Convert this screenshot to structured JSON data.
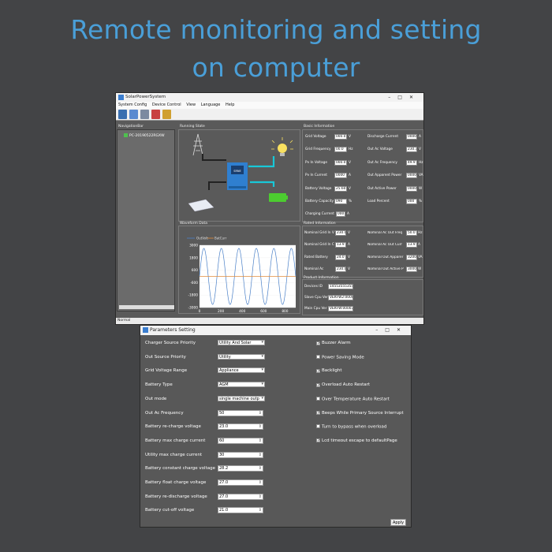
{
  "headline": {
    "line1": "Remote monitoring and setting",
    "line2": "on computer"
  },
  "main_window": {
    "title": "SolarPowerSystem",
    "menu": [
      "System Config",
      "Device Control",
      "View",
      "Language",
      "Help"
    ],
    "nav_label": "NavigationBar",
    "nav_item": "PC-20190522RGXW",
    "running_label": "Running State",
    "wave_label": "Waveform Data",
    "status": "Normal",
    "basic_label": "Basic Information",
    "basic_left": [
      {
        "label": "Grid Voltage",
        "value": "000.0",
        "unit": "V"
      },
      {
        "label": "Grid Frequency",
        "value": "00.0",
        "unit": "Hz"
      },
      {
        "label": "Pv In Voltage",
        "value": "000.0",
        "unit": "V"
      },
      {
        "label": "Pv In Current",
        "value": "0000",
        "unit": "A"
      },
      {
        "label": "Battery Voltage",
        "value": "25.60",
        "unit": "V"
      },
      {
        "label": "Battery Capacity",
        "value": "090",
        "unit": "%"
      },
      {
        "label": "Charging Current",
        "value": "000",
        "unit": "A"
      }
    ],
    "basic_right": [
      {
        "label": "Discharge Current",
        "value": "0000",
        "unit": "A"
      },
      {
        "label": "Out Ac Voltage",
        "value": "230.1",
        "unit": "V"
      },
      {
        "label": "Out Ac Frequency",
        "value": "49.9",
        "unit": "Hz"
      },
      {
        "label": "Out Apparent Power",
        "value": "0000",
        "unit": "VA"
      },
      {
        "label": "Out Active Power",
        "value": "0000",
        "unit": "W"
      },
      {
        "label": "Load Percent",
        "value": "000",
        "unit": "%"
      }
    ],
    "rated_label": "Rated Information",
    "rated_left": [
      {
        "label": "Nominal Grid In V",
        "value": "230.0",
        "unit": "V"
      },
      {
        "label": "Nominal Grid In C",
        "value": "13.9",
        "unit": "A"
      },
      {
        "label": "Rated Battery",
        "value": "24.0",
        "unit": "V"
      },
      {
        "label": "Nominal Ac",
        "value": "230.0",
        "unit": "V"
      }
    ],
    "rated_right": [
      {
        "label": "Nominal Ac Out Freq",
        "value": "50.0",
        "unit": "Hz"
      },
      {
        "label": "Nominal Ac Out Curr",
        "value": "13.9",
        "unit": "A"
      },
      {
        "label": "Nominal Out Apparer",
        "value": "3200",
        "unit": "VA"
      },
      {
        "label": "Nominal Out Active P",
        "value": "3000",
        "unit": "W"
      }
    ],
    "product_label": "Product Information",
    "product": [
      {
        "label": "Devices ID",
        "value": "14553555355"
      },
      {
        "label": "Slave Cpu Ver",
        "value": "VERFW2:0000"
      },
      {
        "label": "Main Cpu Ver",
        "value": "VERFW:00007"
      }
    ],
    "wave_legend": [
      "OutVolt",
      "BatCurr"
    ],
    "inverter_logo": "SRNE",
    "colors": {
      "out_volt": "#4a80c8",
      "bat_curr": "#e08c3c",
      "flow": "#18c8d8"
    }
  },
  "chart_data": {
    "type": "line",
    "title": "",
    "xlabel": "",
    "ylabel": "",
    "xlim": [
      0,
      900
    ],
    "ylim": [
      -3000,
      3000
    ],
    "yticks": [
      3000,
      1800,
      600,
      -600,
      -1800,
      -3000
    ],
    "xticks": [
      0,
      200,
      400,
      600,
      800
    ],
    "series": [
      {
        "name": "OutVolt",
        "waveform": "sine",
        "amplitude": 2700,
        "cycles": 5.5
      },
      {
        "name": "BatCurr",
        "waveform": "flat",
        "value": 0
      }
    ]
  },
  "params_window": {
    "title": "Parameters Setting",
    "apply": "Apply",
    "selects": [
      {
        "label": "Charger Source Priority",
        "value": "Utility And Solar"
      },
      {
        "label": "Out Source Priority",
        "value": "Utility"
      },
      {
        "label": "Grid Voltage Range",
        "value": "Appliance"
      },
      {
        "label": "Battery Type",
        "value": "AGM"
      },
      {
        "label": "Out mode",
        "value": "single machine outp"
      }
    ],
    "spins": [
      {
        "label": "Out Ac Frequency",
        "value": "50"
      },
      {
        "label": "Battery re-charge voltage",
        "value": "23.0"
      },
      {
        "label": "Battery max charge current",
        "value": "60"
      },
      {
        "label": "Utility max charge current",
        "value": "30"
      },
      {
        "label": "Battery constant charge voltage",
        "value": "28.2"
      },
      {
        "label": "Battery float charge voltage",
        "value": "27.0"
      },
      {
        "label": "Battery re-discharge voltage",
        "value": "27.0"
      },
      {
        "label": "Battery cut-off voltage",
        "value": "21.0"
      }
    ],
    "checks": [
      {
        "label": "Buzzer Alarm",
        "checked": true
      },
      {
        "label": "Power Saving Mode",
        "checked": false
      },
      {
        "label": "Backlight",
        "checked": true
      },
      {
        "label": "Overload Auto Restart",
        "checked": true
      },
      {
        "label": "Over Temperature Auto Restart",
        "checked": false
      },
      {
        "label": "Beeps While Primary Source Interrupt",
        "checked": true
      },
      {
        "label": "Turn to bypass when overload",
        "checked": false
      },
      {
        "label": "Lcd timeout escape to defaultPage",
        "checked": true
      }
    ]
  }
}
